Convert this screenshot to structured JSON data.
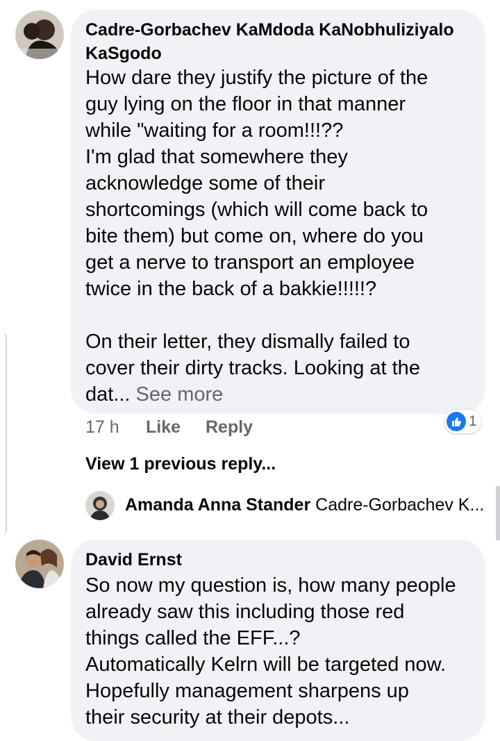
{
  "comments": [
    {
      "author": "Cadre-Gorbachev KaMdoda KaNobhuliziyalo\nKaSgodo",
      "text": "How dare they justify the picture of the\nguy lying on the floor in that manner\nwhile \"waiting for a room!!!??\nI'm glad that somewhere they\nacknowledge some of their\nshortcomings (which will come back to\nbite them) but come on, where do you\nget a nerve to transport an employee\ntwice in the back of a bakkie!!!!!?\n\nOn their letter, they dismally failed to\ncover their dirty tracks. Looking at the\ndat... ",
      "see_more": "See more",
      "time": "17 h",
      "like_label": "Like",
      "reply_label": "Reply",
      "reaction_count": "1",
      "reaction_icon": "like-icon",
      "view_replies": "View 1 previous reply...",
      "reply_preview": {
        "author": "Amanda Anna Stander",
        "text": "Cadre-Gorbachev K..."
      }
    },
    {
      "author": "David Ernst",
      "text": "So now my question is, how many people\nalready saw this including those red\nthings called the EFF...?\nAutomatically Kelrn will be targeted now.\nHopefully management sharpens up\ntheir security at their depots..."
    }
  ],
  "colors": {
    "bubble": "#f0f2f5",
    "secondary_text": "#65676b",
    "like_blue": "#1877f2"
  }
}
